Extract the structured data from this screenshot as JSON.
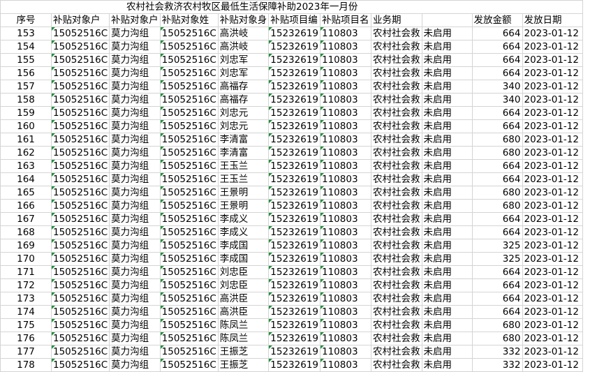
{
  "sheet": {
    "title": "农村社会救济农村牧区最低生活保障补助2023年一月份",
    "headers": [
      "序号",
      "补贴对象户",
      "补贴对象户",
      "补贴对象姓",
      "补贴对象身",
      "补贴项目编",
      "补贴项目名",
      "业务期",
      "发放金额",
      "发放日期"
    ],
    "rows": [
      [
        "153",
        "15052516C",
        "莫力沟组",
        "15052516C",
        "高洪岐",
        "15232619",
        "110803",
        "农村社会救",
        "未启用",
        "664",
        "2023-01-12"
      ],
      [
        "154",
        "15052516C",
        "莫力沟组",
        "15052516C",
        "高洪岐",
        "15232619",
        "110803",
        "农村社会救",
        "未启用",
        "664",
        "2023-01-12"
      ],
      [
        "155",
        "15052516C",
        "莫力沟组",
        "15052516C",
        "刘忠军",
        "15232619",
        "110803",
        "农村社会救",
        "未启用",
        "664",
        "2023-01-12"
      ],
      [
        "156",
        "15052516C",
        "莫力沟组",
        "15052516C",
        "刘忠军",
        "15232619",
        "110803",
        "农村社会救",
        "未启用",
        "664",
        "2023-01-12"
      ],
      [
        "157",
        "15052516C",
        "莫力沟组",
        "15052516C",
        "高福存",
        "15232619",
        "110803",
        "农村社会救",
        "未启用",
        "340",
        "2023-01-12"
      ],
      [
        "158",
        "15052516C",
        "莫力沟组",
        "15052516C",
        "高福存",
        "15232619",
        "110803",
        "农村社会救",
        "未启用",
        "340",
        "2023-01-12"
      ],
      [
        "159",
        "15052516C",
        "莫力沟组",
        "15052516C",
        "刘忠元",
        "15232619",
        "110803",
        "农村社会救",
        "未启用",
        "664",
        "2023-01-12"
      ],
      [
        "160",
        "15052516C",
        "莫力沟组",
        "15052516C",
        "刘忠元",
        "15232619",
        "110803",
        "农村社会救",
        "未启用",
        "664",
        "2023-01-12"
      ],
      [
        "161",
        "15052516C",
        "莫力沟组",
        "15052516C",
        "李清富",
        "15232619",
        "110803",
        "农村社会救",
        "未启用",
        "680",
        "2023-01-12"
      ],
      [
        "162",
        "15052516C",
        "莫力沟组",
        "15052516C",
        "李清富",
        "15232619",
        "110803",
        "农村社会救",
        "未启用",
        "680",
        "2023-01-12"
      ],
      [
        "163",
        "15052516C",
        "莫力沟组",
        "15052516C",
        "王玉兰",
        "15232619",
        "110803",
        "农村社会救",
        "未启用",
        "664",
        "2023-01-12"
      ],
      [
        "164",
        "15052516C",
        "莫力沟组",
        "15052516C",
        "王玉兰",
        "15232619",
        "110803",
        "农村社会救",
        "未启用",
        "664",
        "2023-01-12"
      ],
      [
        "165",
        "15052516C",
        "莫力沟组",
        "15052516C",
        "王景明",
        "15232619",
        "110803",
        "农村社会救",
        "未启用",
        "680",
        "2023-01-12"
      ],
      [
        "166",
        "15052516C",
        "莫力沟组",
        "15052516C",
        "王景明",
        "15232619",
        "110803",
        "农村社会救",
        "未启用",
        "680",
        "2023-01-12"
      ],
      [
        "167",
        "15052516C",
        "莫力沟组",
        "15052516C",
        "李成义",
        "15232619",
        "110803",
        "农村社会救",
        "未启用",
        "664",
        "2023-01-12"
      ],
      [
        "168",
        "15052516C",
        "莫力沟组",
        "15052516C",
        "李成义",
        "15232619",
        "110803",
        "农村社会救",
        "未启用",
        "664",
        "2023-01-12"
      ],
      [
        "169",
        "15052516C",
        "莫力沟组",
        "15052516C",
        "李成国",
        "15232619",
        "110803",
        "农村社会救",
        "未启用",
        "325",
        "2023-01-12"
      ],
      [
        "170",
        "15052516C",
        "莫力沟组",
        "15052516C",
        "李成国",
        "15232619",
        "110803",
        "农村社会救",
        "未启用",
        "325",
        "2023-01-12"
      ],
      [
        "171",
        "15052516C",
        "莫力沟组",
        "15052516C",
        "刘忠臣",
        "15232619",
        "110803",
        "农村社会救",
        "未启用",
        "664",
        "2023-01-12"
      ],
      [
        "172",
        "15052516C",
        "莫力沟组",
        "15052516C",
        "刘忠臣",
        "15232619",
        "110803",
        "农村社会救",
        "未启用",
        "664",
        "2023-01-12"
      ],
      [
        "173",
        "15052516C",
        "莫力沟组",
        "15052516C",
        "高洪臣",
        "15232619",
        "110803",
        "农村社会救",
        "未启用",
        "664",
        "2023-01-12"
      ],
      [
        "174",
        "15052516C",
        "莫力沟组",
        "15052516C",
        "高洪臣",
        "15232619",
        "110803",
        "农村社会救",
        "未启用",
        "664",
        "2023-01-12"
      ],
      [
        "175",
        "15052516C",
        "莫力沟组",
        "15052516C",
        "陈凤兰",
        "15232619",
        "110803",
        "农村社会救",
        "未启用",
        "680",
        "2023-01-12"
      ],
      [
        "176",
        "15052516C",
        "莫力沟组",
        "15052516C",
        "陈凤兰",
        "15232619",
        "110803",
        "农村社会救",
        "未启用",
        "680",
        "2023-01-12"
      ],
      [
        "177",
        "15052516C",
        "莫力沟组",
        "15052516C",
        "王振芝",
        "15232619",
        "110803",
        "农村社会救",
        "未启用",
        "332",
        "2023-01-12"
      ],
      [
        "178",
        "15052516C",
        "莫力沟组",
        "15052516C",
        "王振芝",
        "15232619",
        "110803",
        "农村社会救",
        "未启用",
        "332",
        "2023-01-12"
      ]
    ]
  },
  "colors": {
    "grid_line": "#d4d4d4",
    "number_as_text_marker": "#1f8f3a"
  }
}
